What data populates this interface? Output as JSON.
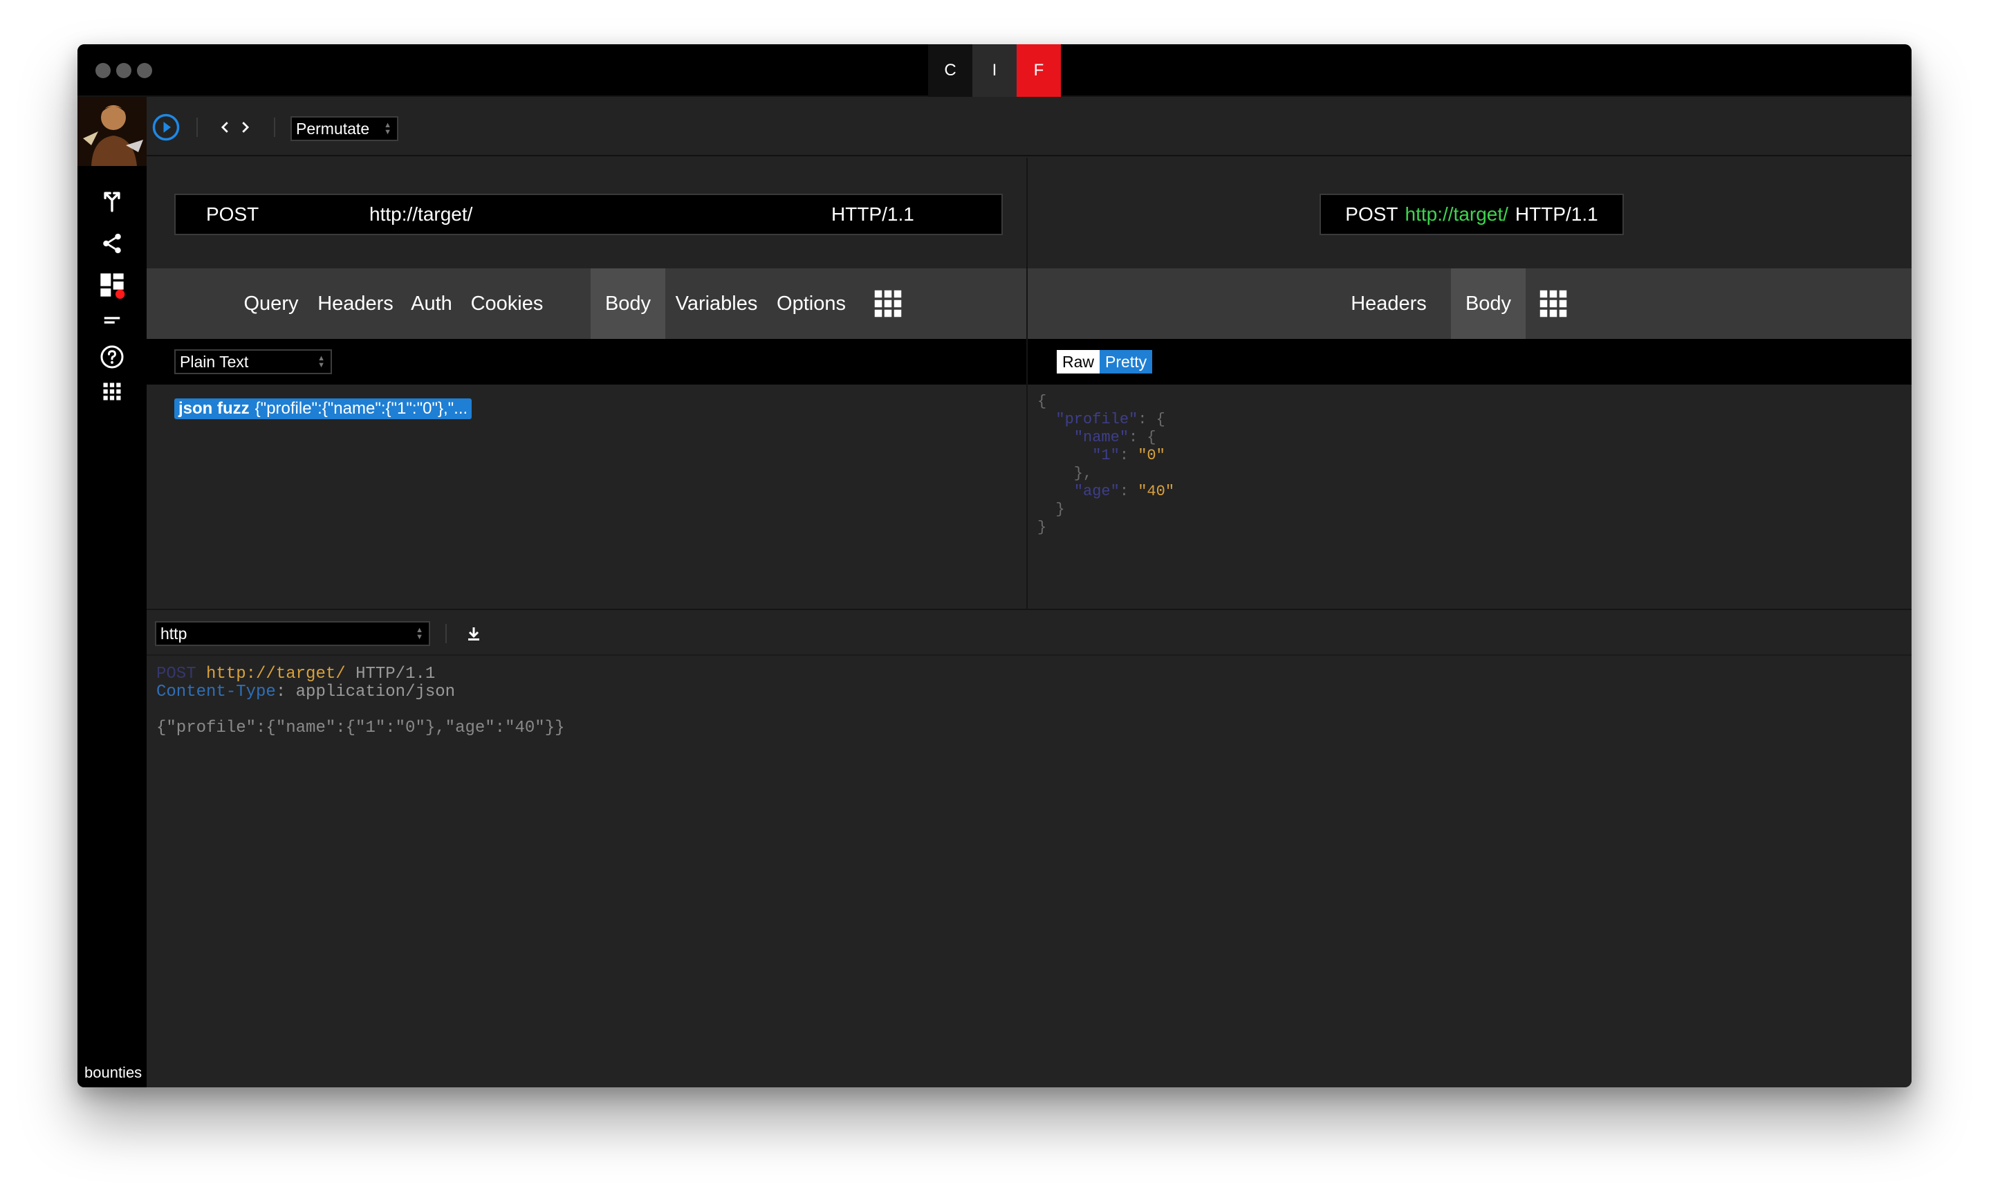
{
  "window": {
    "mode_tabs": [
      {
        "label": "C",
        "bg": "#111111"
      },
      {
        "label": "I",
        "bg": "#2b2b2b"
      },
      {
        "label": "F",
        "bg": "#e8141c"
      }
    ]
  },
  "sidebar": {
    "items": [
      {
        "icon": "fork-icon"
      },
      {
        "icon": "share-icon"
      },
      {
        "icon": "dashboard-icon",
        "badge_color": "#ff1a1a"
      },
      {
        "icon": "lines-icon"
      },
      {
        "icon": "help-icon"
      },
      {
        "icon": "grid-icon"
      }
    ],
    "footer_label": "bounties"
  },
  "toolbar": {
    "mode_select": "Permutate"
  },
  "request": {
    "method": "POST",
    "url": "http://target/",
    "protocol": "HTTP/1.1",
    "tabs": [
      "Query",
      "Headers",
      "Auth",
      "Cookies",
      "Body",
      "Variables",
      "Options"
    ],
    "active_tab": "Body",
    "body_type": "Plain Text",
    "fuzz_label": "json fuzz",
    "fuzz_value": "{\"profile\":{\"name\":{\"1\":\"0\"},\"..."
  },
  "response": {
    "method": "POST",
    "url": "http://target/",
    "protocol": "HTTP/1.1",
    "url_color": "#3fd44f",
    "tabs": [
      "Headers",
      "Body"
    ],
    "active_tab": "Body",
    "view_raw": "Raw",
    "view_pretty": "Pretty",
    "json_lines": {
      "l1": "{",
      "k_profile": "\"profile\"",
      "k_name": "\"name\"",
      "k_1": "\"1\"",
      "v_0": "\"0\"",
      "k_age": "\"age\"",
      "v_40": "\"40\""
    }
  },
  "output": {
    "format_select": "http",
    "line1_method": "POST",
    "line1_url": "http://target/",
    "line1_proto": "HTTP/1.1",
    "header_name": "Content-Type",
    "header_value": "application/json",
    "body": "{\"profile\":{\"name\":{\"1\":\"0\"},\"age\":\"40\"}}"
  }
}
